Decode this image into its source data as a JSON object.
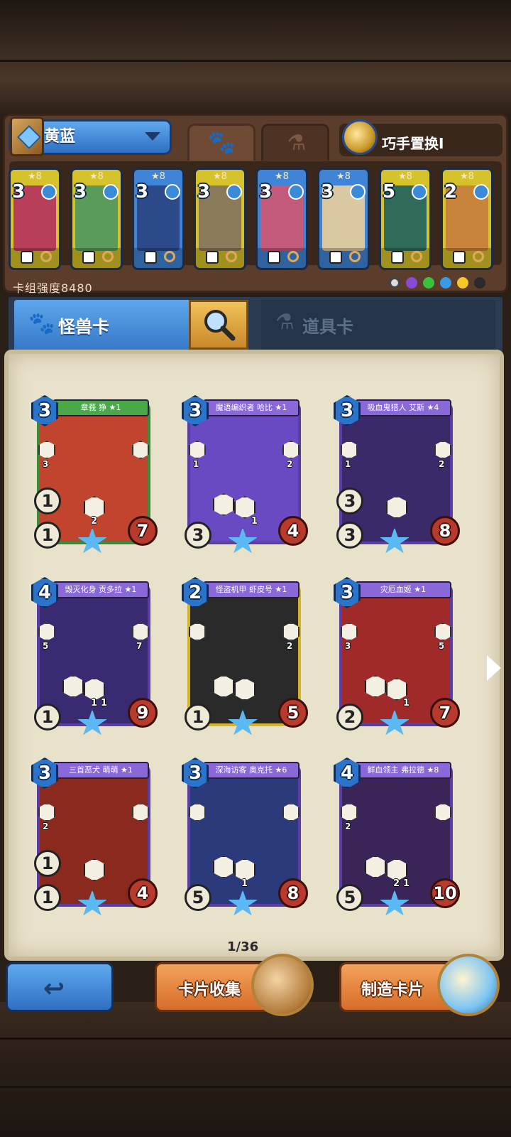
{
  "deck": {
    "name": "黄蓝",
    "power_label": "卡组强度8480",
    "swap_label": "巧手置换I",
    "cards": [
      {
        "cost": "3",
        "stars": "★8",
        "color": "#d6c22a",
        "art": "#b73f5a"
      },
      {
        "cost": "3",
        "stars": "★8",
        "color": "#d6c22a",
        "art": "#5a9a5a"
      },
      {
        "cost": "3",
        "stars": "★8",
        "color": "#3f84d6",
        "art": "#2c4a8a"
      },
      {
        "cost": "3",
        "stars": "★8",
        "color": "#d6c22a",
        "art": "#8a7a5a"
      },
      {
        "cost": "3",
        "stars": "★8",
        "color": "#3f84d6",
        "art": "#c45a7a"
      },
      {
        "cost": "3",
        "stars": "★8",
        "color": "#3f84d6",
        "art": "#d9c8a0"
      },
      {
        "cost": "5",
        "stars": "★8",
        "color": "#d6c22a",
        "art": "#2f6a5a"
      },
      {
        "cost": "2",
        "stars": "★8",
        "color": "#d6c22a",
        "art": "#c8843a"
      }
    ]
  },
  "tabs": {
    "monster_label": "怪兽卡",
    "item_label": "道具卡"
  },
  "collection": {
    "page": "1/36",
    "cards": [
      {
        "name": "章莪 狰 ★1",
        "cost": "3",
        "hp": "7",
        "stat1": "1",
        "stat2": "1",
        "side_left": "3",
        "side_right": "",
        "mini1": "2",
        "mini2": "",
        "art": "#c0442e",
        "banner": "#4aa84a",
        "frame": "#3a8a3a"
      },
      {
        "name": "魔语编织者 哈比 ★1",
        "cost": "3",
        "hp": "4",
        "stat1": "",
        "stat2": "3",
        "side_left": "1",
        "side_right": "2",
        "mini1": "",
        "mini2": "1",
        "art": "#6a4ac2",
        "banner": "#8a68d8",
        "frame": "#5a3ea6"
      },
      {
        "name": "吸血鬼猎人 艾斯 ★4",
        "cost": "3",
        "hp": "8",
        "stat1": "3",
        "stat2": "3",
        "side_left": "1",
        "side_right": "2",
        "mini1": "",
        "mini2": "",
        "art": "#3a2a6a",
        "banner": "#8a68d8",
        "frame": "#5a3ea6"
      },
      {
        "name": "毁灭化身 贡多拉 ★1",
        "cost": "4",
        "hp": "9",
        "stat1": "",
        "stat2": "1",
        "side_left": "5",
        "side_right": "7",
        "mini1": "1",
        "mini2": "1",
        "art": "#3a2a72",
        "banner": "#8a68d8",
        "frame": "#5a3ea6"
      },
      {
        "name": "怪盗机甲 虾皮号 ★1",
        "cost": "2",
        "hp": "5",
        "stat1": "",
        "stat2": "1",
        "side_left": "",
        "side_right": "2",
        "mini1": "",
        "mini2": "",
        "art": "#2a2a2a",
        "banner": "#8a68d8",
        "frame": "#d6b42a"
      },
      {
        "name": "灾厄血姬 ★1",
        "cost": "3",
        "hp": "7",
        "stat1": "",
        "stat2": "2",
        "side_left": "3",
        "side_right": "5",
        "mini1": "",
        "mini2": "1",
        "art": "#a02a2a",
        "banner": "#8a68d8",
        "frame": "#5a3ea6"
      },
      {
        "name": "三首恶犬 萌萌 ★1",
        "cost": "3",
        "hp": "4",
        "stat1": "1",
        "stat2": "1",
        "side_left": "2",
        "side_right": "",
        "mini1": "",
        "mini2": "",
        "art": "#8a2a1e",
        "banner": "#8a68d8",
        "frame": "#5a3ea6"
      },
      {
        "name": "深海访客 奥克托 ★6",
        "cost": "3",
        "hp": "8",
        "stat1": "",
        "stat2": "5",
        "side_left": "",
        "side_right": "",
        "mini1": "1",
        "mini2": "",
        "art": "#2a3a7a",
        "banner": "#8a68d8",
        "frame": "#5a3ea6"
      },
      {
        "name": "鲜血领主 弗拉德 ★8",
        "cost": "4",
        "hp": "10",
        "stat1": "",
        "stat2": "5",
        "side_left": "2",
        "side_right": "",
        "mini1": "2",
        "mini2": "1",
        "art": "#3a2458",
        "banner": "#8a68d8",
        "frame": "#5a3ea6"
      }
    ]
  },
  "buttons": {
    "collect_label": "卡片收集",
    "craft_label": "制造卡片"
  }
}
